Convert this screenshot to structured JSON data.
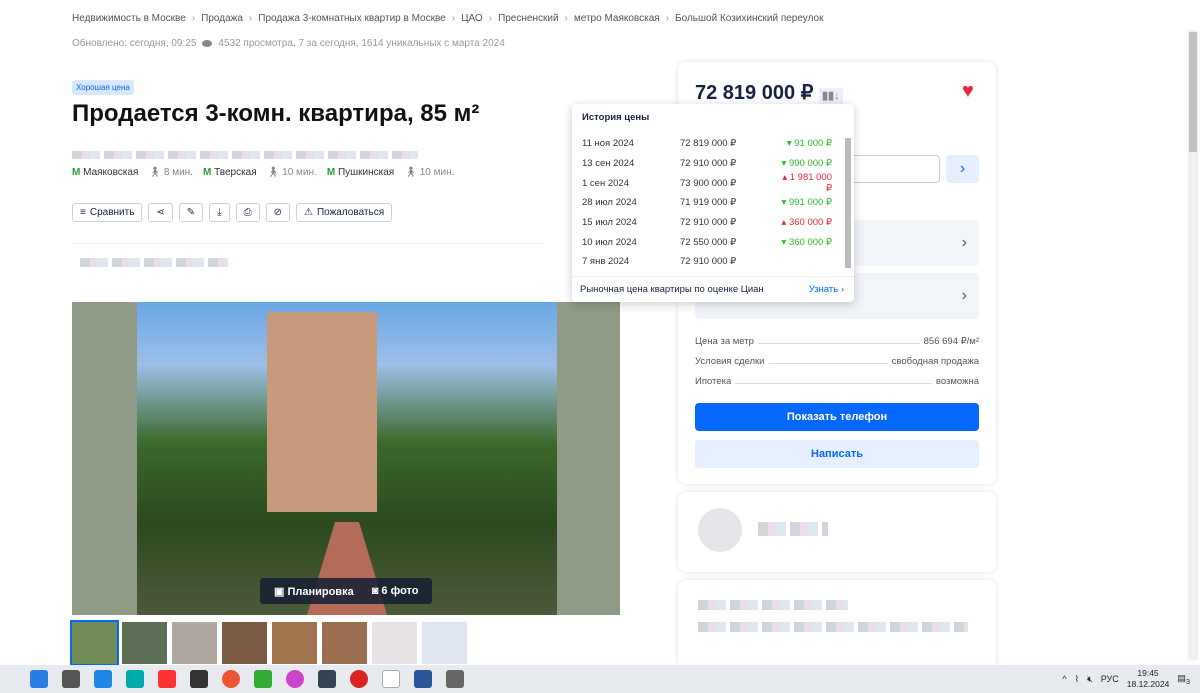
{
  "breadcrumbs": [
    "Недвижимость в Москве",
    "Продажа",
    "Продажа 3-комнатных квартир в Москве",
    "ЦАО",
    "Пресненский",
    "метро Маяковская",
    "Большой Козихинский переулок"
  ],
  "meta": {
    "updated": "Обновлено: сегодня, 09:25",
    "views": "4532 просмотра, 7 за сегодня, 1614 уникальных с марта 2024"
  },
  "badge": "Хорошая цена",
  "title": "Продается 3-комн. квартира, 85 м²",
  "metro": [
    {
      "name": "Маяковская",
      "time": "8 мин."
    },
    {
      "name": "Тверская",
      "time": "10 мин."
    },
    {
      "name": "Пушкинская",
      "time": "10 мин."
    }
  ],
  "metro_icon": "М",
  "toolbar": {
    "compare": "Сравнить",
    "complain": "Пожаловаться"
  },
  "photo": {
    "plan": "Планировка",
    "photos": "6 фото"
  },
  "price": "72 819 000 ₽",
  "price_history": {
    "title": "История цены",
    "rows": [
      {
        "date": "11 ноя 2024",
        "price": "72 819 000 ₽",
        "change": "91 000 ₽",
        "dir": "down"
      },
      {
        "date": "13 сен 2024",
        "price": "72 910 000 ₽",
        "change": "990 000 ₽",
        "dir": "down"
      },
      {
        "date": "1 сен 2024",
        "price": "73 900 000 ₽",
        "change": "1 981 000 ₽",
        "dir": "up"
      },
      {
        "date": "28 июл 2024",
        "price": "71 919 000 ₽",
        "change": "991 000 ₽",
        "dir": "down"
      },
      {
        "date": "15 июл 2024",
        "price": "72 910 000 ₽",
        "change": "360 000 ₽",
        "dir": "up"
      },
      {
        "date": "10 июл 2024",
        "price": "72 550 000 ₽",
        "change": "360 000 ₽",
        "dir": "down"
      },
      {
        "date": "7 янв 2024",
        "price": "72 910 000 ₽",
        "change": "",
        "dir": ""
      }
    ],
    "footer": "Рыночная цена квартиры по оценке Циан",
    "footer_link": "Узнать"
  },
  "details": [
    {
      "label": "Цена за метр",
      "value": "856 694 ₽/м²"
    },
    {
      "label": "Условия сделки",
      "value": "свободная продажа"
    },
    {
      "label": "Ипотека",
      "value": "возможна"
    }
  ],
  "buttons": {
    "phone": "Показать телефон",
    "write": "Написать"
  },
  "taskbar": {
    "lang": "РУС",
    "time": "19:45",
    "date": "18.12.2024",
    "notifications": "3"
  },
  "colors": {
    "accent": "#0468ff",
    "down": "#2eb82e",
    "up": "#e8263a"
  }
}
